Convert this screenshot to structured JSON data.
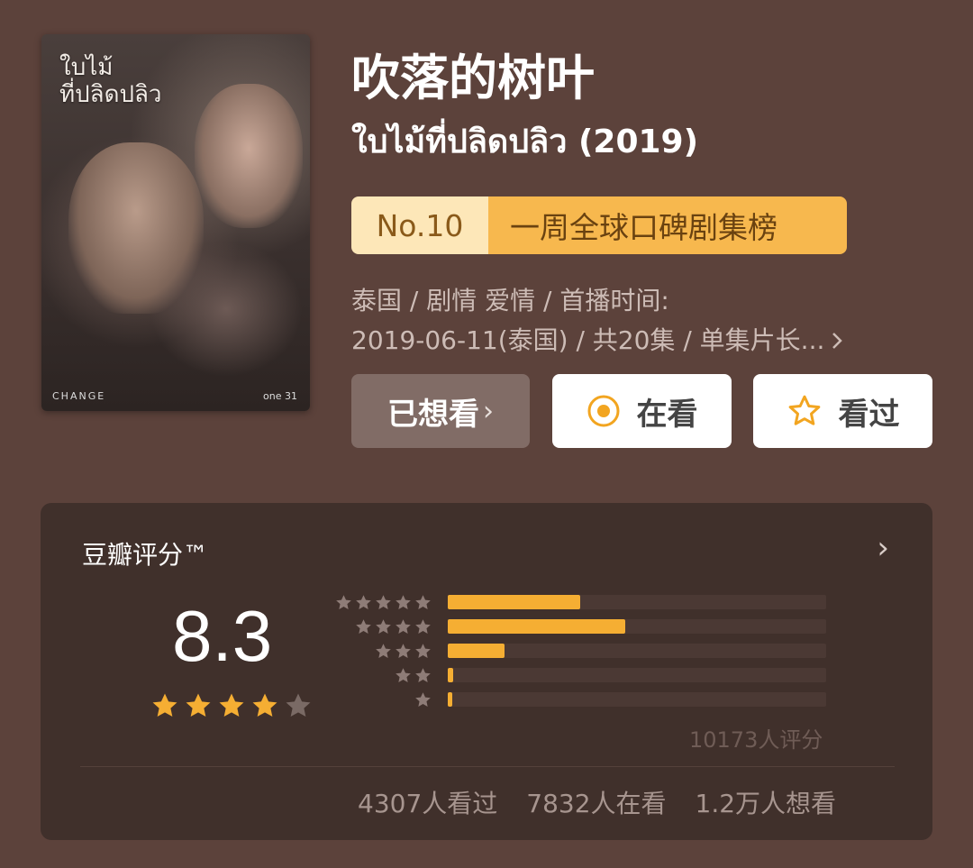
{
  "poster": {
    "title_art": "ใบไม้\nที่ปลิดปลิว",
    "brand": "CHANGE",
    "channel_logo": "one 31"
  },
  "title_zh": "吹落的树叶",
  "title_original": "ใบไม้ที่ปลิดปลิว (2019)",
  "rank": {
    "number": "No.10",
    "list_name": "一周全球口碑剧集榜"
  },
  "meta": {
    "line1": "泰国 / 剧情 爱情 / 首播时间:",
    "line2": "2019-06-11(泰国) / 共20集 / 单集片长...",
    "more_icon": "chevron-right-icon"
  },
  "actions": {
    "wished_label": "已想看",
    "wished_chevron": "›",
    "watching_label": "在看",
    "watched_label": "看过"
  },
  "rating": {
    "label": "豆瓣评分™",
    "score": "8.3",
    "stars_filled": 4,
    "stars_total": 5,
    "distribution": [
      {
        "stars": 5,
        "fraction": 0.35
      },
      {
        "stars": 4,
        "fraction": 0.47
      },
      {
        "stars": 3,
        "fraction": 0.15
      },
      {
        "stars": 2,
        "fraction": 0.015
      },
      {
        "stars": 1,
        "fraction": 0.01
      }
    ],
    "count_text": "10173人评分",
    "chevron": "›"
  },
  "stats": {
    "watched": "4307人看过",
    "watching": "7832人在看",
    "wished": "1.2万人想看"
  },
  "colors": {
    "background": "#5c423b",
    "card": "#40302b",
    "accent_orange": "#f5ae33",
    "badge_light": "#fde7b8",
    "badge_dark": "#f7b84e"
  }
}
